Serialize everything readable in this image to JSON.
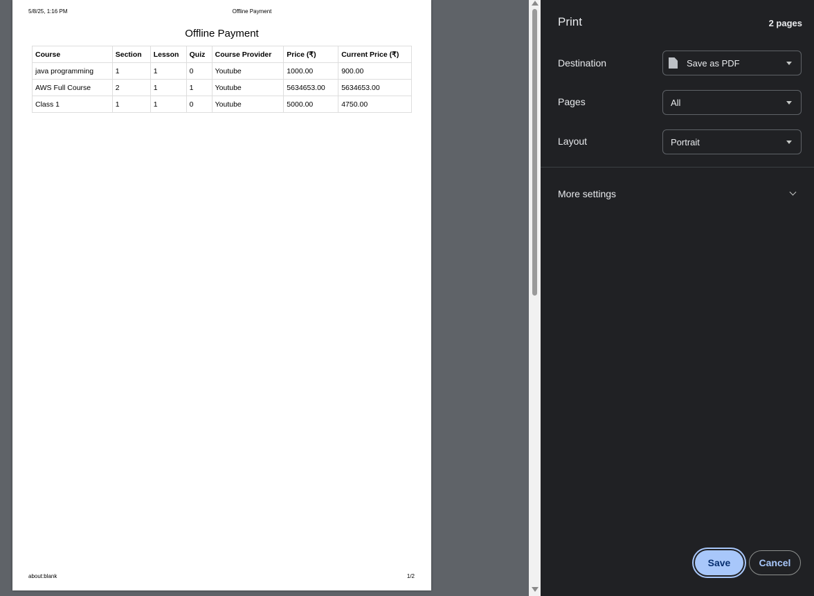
{
  "preview": {
    "header_date": "5/8/25, 1:16 PM",
    "header_title": "Offline Payment",
    "doc_title": "Offline Payment",
    "footer_url": "about:blank",
    "footer_page": "1/2",
    "table": {
      "headers": [
        "Course",
        "Section",
        "Lesson",
        "Quiz",
        "Course Provider",
        "Price (₹)",
        "Current Price (₹)"
      ],
      "rows": [
        [
          "java programming",
          "1",
          "1",
          "0",
          "Youtube",
          "1000.00",
          "900.00"
        ],
        [
          "AWS Full Course",
          "2",
          "1",
          "1",
          "Youtube",
          "5634653.00",
          "5634653.00"
        ],
        [
          "Class 1",
          "1",
          "1",
          "0",
          "Youtube",
          "5000.00",
          "4750.00"
        ]
      ]
    }
  },
  "print_panel": {
    "title": "Print",
    "page_count": "2 pages",
    "destination": {
      "label": "Destination",
      "value": "Save as PDF",
      "icon": "document-icon"
    },
    "pages": {
      "label": "Pages",
      "value": "All"
    },
    "layout": {
      "label": "Layout",
      "value": "Portrait"
    },
    "more_settings": "More settings",
    "save_label": "Save",
    "cancel_label": "Cancel"
  },
  "colors": {
    "panel_bg": "#202124",
    "preview_bg": "#5f6368",
    "accent": "#a8c7fa"
  }
}
